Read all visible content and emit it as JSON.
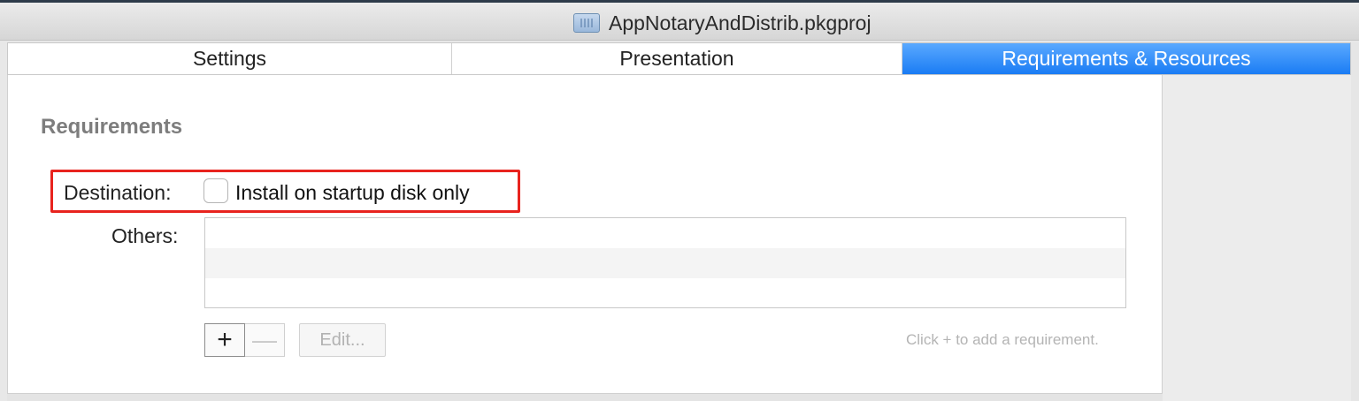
{
  "window": {
    "title": "AppNotaryAndDistrib.pkgproj",
    "icon": "pkgproj-document-icon"
  },
  "tabs": [
    {
      "label": "Settings",
      "active": false
    },
    {
      "label": "Presentation",
      "active": false
    },
    {
      "label": "Requirements & Resources",
      "active": true
    }
  ],
  "requirements": {
    "section_title": "Requirements",
    "destination_label": "Destination:",
    "startup_disk_checkbox": {
      "label": "Install on startup disk only",
      "checked": false
    },
    "others_label": "Others:",
    "others_list": [],
    "add_button": "+",
    "remove_button": "—",
    "edit_button": "Edit...",
    "hint": "Click + to add a requirement."
  },
  "colors": {
    "active_tab": "#1a7cf4",
    "highlight_border": "#e8231e"
  }
}
